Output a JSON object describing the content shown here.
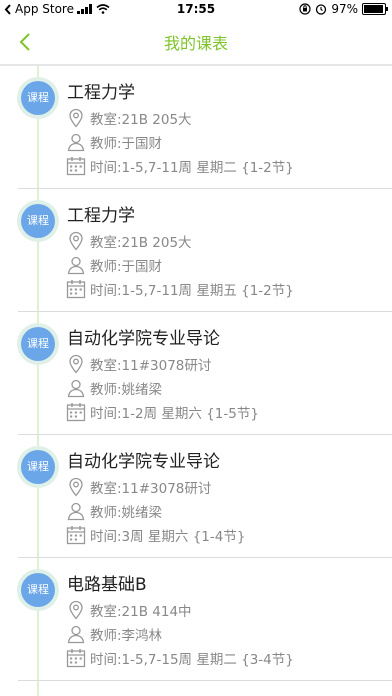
{
  "status_bar": {
    "back_app": "App Store",
    "time": "17:55",
    "battery": "97%",
    "battery_level": 0.97
  },
  "nav": {
    "title": "我的课表"
  },
  "badge_label": "课程",
  "courses": [
    {
      "name": "工程力学",
      "room": "教室:21B 205大",
      "teacher": "教师:于国财",
      "time": "时间:1-5,7-11周 星期二 {1-2节}"
    },
    {
      "name": "工程力学",
      "room": "教室:21B 205大",
      "teacher": "教师:于国财",
      "time": "时间:1-5,7-11周 星期五 {1-2节}"
    },
    {
      "name": "自动化学院专业导论",
      "room": "教室:11#3078研讨",
      "teacher": "教师:姚绪梁",
      "time": "时间:1-2周 星期六 {1-5节}"
    },
    {
      "name": "自动化学院专业导论",
      "room": "教室:11#3078研讨",
      "teacher": "教师:姚绪梁",
      "time": "时间:3周 星期六 {1-4节}"
    },
    {
      "name": "电路基础B",
      "room": "教室:21B 414中",
      "teacher": "教师:李鸿林",
      "time": "时间:1-5,7-15周 星期二 {3-4节}"
    }
  ],
  "colors": {
    "accent": "#7fc42a",
    "badge": "#6aa6e8",
    "badge_ring": "#dff0e8",
    "meta_text": "#888888"
  },
  "icons": {
    "room": "location-pin-icon",
    "teacher": "person-icon",
    "time": "calendar-icon"
  }
}
